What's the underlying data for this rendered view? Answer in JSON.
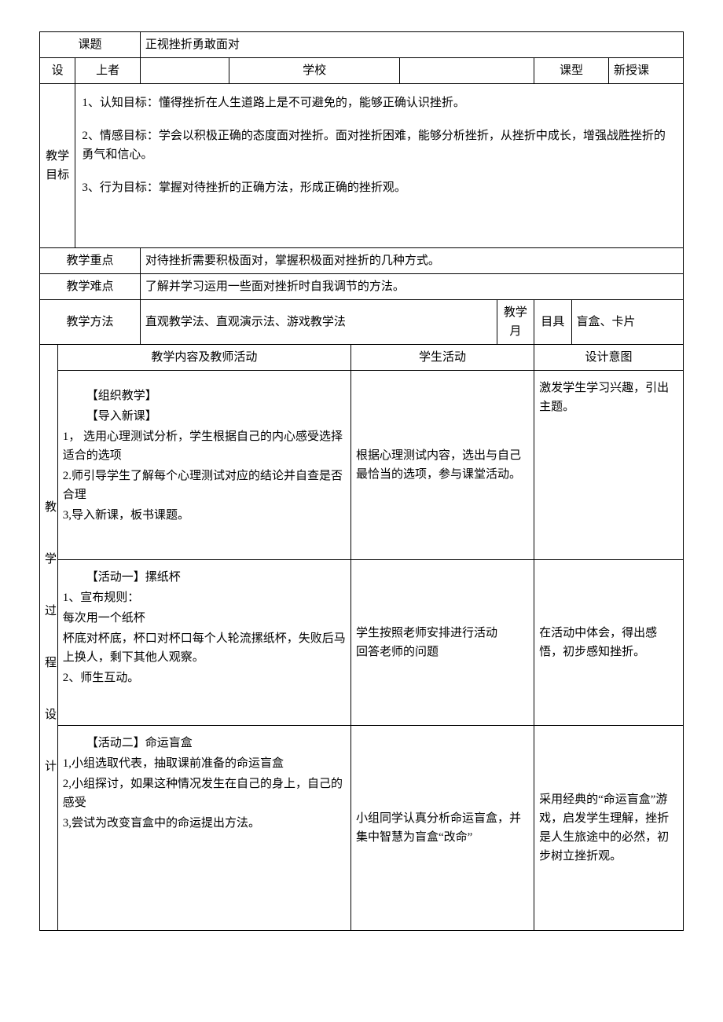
{
  "header": {
    "topic_label": "课题",
    "topic_value": "正视挫折勇敢面对",
    "designer_label1": "设",
    "designer_label2": "上者",
    "school_label": "学校",
    "class_type_label": "课型",
    "class_type_value": "新授课"
  },
  "goals": {
    "label": "教学目标",
    "g1": "1、认知目标：懂得挫折在人生道路上是不可避免的，能够正确认识挫折。",
    "g2": "2、情感目标：学会以积极正确的态度面对挫折。面对挫折困难，能够分析挫折，从挫折中成长，增强战胜挫折的勇气和信心。",
    "g3": "3、行为目标：掌握对待挫折的正确方法，形成正确的挫折观。"
  },
  "focus": {
    "key_label": "教学重点",
    "key_value": "对待挫折需要积极面对，掌握积极面对挫折的几种方式。",
    "diff_label": "教学难点",
    "diff_value": "了解并学习运用一些面对挫折时自我调节的方法。",
    "method_label": "教学方法",
    "method_value": "直观教学法、直观演示法、游戏教学法",
    "tool_label1": "教学月",
    "tool_label2": "目具",
    "tool_value": "盲盒、卡片"
  },
  "process": {
    "vlabel": "教\n\n学\n\n过\n\n程 设\n\n计",
    "col_teacher": "教学内容及教师活动",
    "col_student": "学生活动",
    "col_intent": "设计意图",
    "rows": [
      {
        "teacher": {
          "p1": "【组织教学】",
          "p2": "【导入新课】",
          "p3": "1， 选用心理测试分析，学生根据自己的内心感受选择适合的选项",
          "p4": "2.师引导学生了解每个心理测试对应的结论并自查是否合理",
          "p5": "3,导入新课，板书课题。"
        },
        "student": "根据心理测试内容，选出与自己最恰当的选项，参与课堂活动。",
        "intent": "激发学生学习兴趣，引出主题。"
      },
      {
        "teacher": {
          "p1": "【活动一】摞纸杯",
          "p2": "1、宣布规则：",
          "p3": "每次用一个纸杯",
          "p4": "杯底对杯底，杯口对杯口每个人轮流摞纸杯，失败后马上换人，剩下其他人观察。",
          "p5": "2、师生互动。"
        },
        "student": "学生按照老师安排进行活动\n回答老师的问题",
        "intent": "在活动中体会，得出感悟，初步感知挫折。"
      },
      {
        "teacher": {
          "p1": "【活动二】命运盲盒",
          "p2": "1,小组选取代表，抽取课前准备的命运盲盒",
          "p3": "2,小组探讨，如果这种情况发生在自己的身上，自己的感受",
          "p4": "3,尝试为改变盲盒中的命运提出方法。"
        },
        "student": "小组同学认真分析命运盲盒，并集中智慧为盲盒“改命”",
        "intent": "采用经典的“命运盲盒”游戏，启发学生理解，挫折是人生旅途中的必然，初步树立挫折观。"
      }
    ]
  }
}
